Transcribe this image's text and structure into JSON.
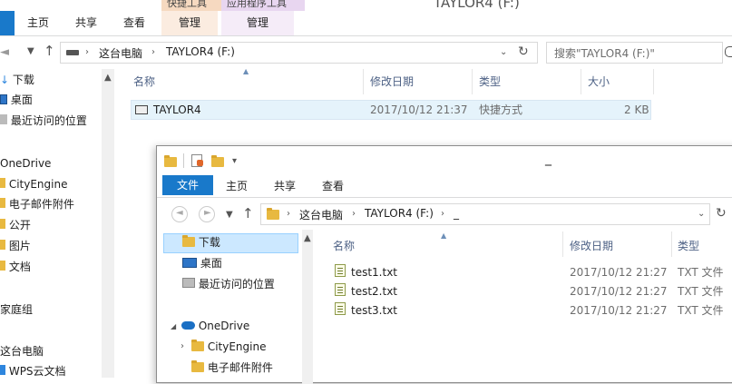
{
  "back_window": {
    "title": "TAYLOR4 (F:)",
    "context_tabs": [
      "快捷工具",
      "应用程序工具"
    ],
    "ribbon_tabs": [
      "主页",
      "共享",
      "查看",
      "管理",
      "管理"
    ],
    "address": [
      "这台电脑",
      "TAYLOR4 (F:)"
    ],
    "search_placeholder": "搜索\"TAYLOR4 (F:)\"",
    "nav_items": [
      "下载",
      "桌面",
      "最近访问的位置",
      "OneDrive",
      "CityEngine",
      "电子邮件附件",
      "公开",
      "图片",
      "文档",
      "家庭组",
      "这台电脑",
      "WPS云文档"
    ],
    "columns": [
      "名称",
      "修改日期",
      "类型",
      "大小"
    ],
    "rows": [
      {
        "name": "TAYLOR4",
        "date": "2017/10/12 21:37",
        "type": "快捷方式",
        "size": "2 KB"
      }
    ]
  },
  "front_window": {
    "title": "_",
    "file_tab": "文件",
    "ribbon_tabs": [
      "主页",
      "共享",
      "查看"
    ],
    "address": [
      "这台电脑",
      "TAYLOR4 (F:)",
      "_"
    ],
    "nav_items": [
      "下载",
      "桌面",
      "最近访问的位置",
      "OneDrive",
      "CityEngine",
      "电子邮件附件"
    ],
    "columns": [
      "名称",
      "修改日期",
      "类型"
    ],
    "rows": [
      {
        "name": "test1.txt",
        "date": "2017/10/12 21:27",
        "type": "TXT 文件"
      },
      {
        "name": "test2.txt",
        "date": "2017/10/12 21:27",
        "type": "TXT 文件"
      },
      {
        "name": "test3.txt",
        "date": "2017/10/12 21:27",
        "type": "TXT 文件"
      }
    ]
  },
  "colors": {
    "file_tab": "#1979ca",
    "selection": "#cce8ff",
    "context_tab1": "#f6d9c0",
    "context_tab2": "#e8d6f0"
  }
}
